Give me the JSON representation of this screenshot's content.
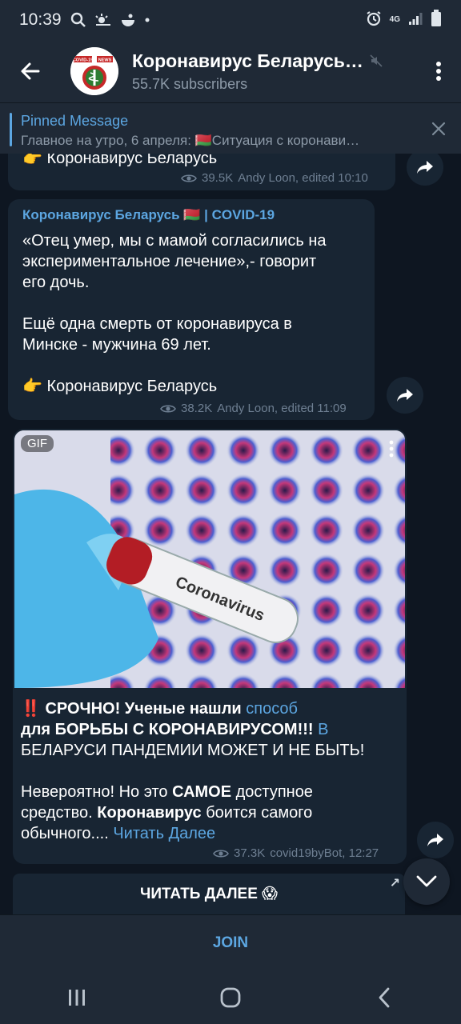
{
  "statusbar": {
    "time": "10:39",
    "network": "4G"
  },
  "header": {
    "back_icon": "arrow-left-icon",
    "title": "Коронавирус Беларусь…",
    "subscribers": "55.7K subscribers",
    "avatar_text_left": "COVID-19",
    "avatar_text_right": "NEWS"
  },
  "pinned": {
    "label": "Pinned Message",
    "text": "Главное на утро, 6 апреля: 🇧🇾Ситуация с коронави…"
  },
  "messages": [
    {
      "link": "👉 Коронавирус Беларусь",
      "views": "39.5K",
      "author": "Andy Loon, edited 10:10"
    },
    {
      "sender": "Коронавирус Беларусь 🇧🇾 | COVID-19",
      "line1": "«Отец умер, мы с мамой согласились на",
      "line2": "экспериментальное лечение»,- говорит",
      "line3": "его дочь.",
      "line4": "Ещё одна смерть от коронавируса в",
      "line5": "Минске - мужчина 69 лет.",
      "link": "👉 Коронавирус Беларусь",
      "views": "38.2K",
      "author": "Andy Loon, edited 11:09"
    },
    {
      "gif_label": "GIF",
      "tube_label": "Coronavirus",
      "p1_a": "‼️ СРОЧНО! Ученые нашли ",
      "p1_b": "способ",
      "p2_a": "для БОРЬБЫ С КОРОНАВИРУСОМ!!! ",
      "p2_b": "В",
      "p3": "БЕЛАРУСИ ПАНДЕМИИ МОЖЕТ И НЕ БЫТЬ!",
      "p4_a": "Невероятно! Но это ",
      "p4_b": "САМОЕ",
      "p4_c": " доступное",
      "p5_a": "средство. ",
      "p5_b": "Коронавирус",
      "p5_c": " боится самого",
      "p6_a": "обычного.... ",
      "p6_b": "Читать Далее",
      "views": "37.3K",
      "author": "covid19byBot, 12:27"
    }
  ],
  "readmore": {
    "label": "ЧИТАТЬ ДАЛЕЕ 😱",
    "arrow": "↗"
  },
  "join": {
    "label": "JOIN"
  },
  "colors": {
    "background": "#0e1621",
    "bubble": "#182533",
    "bar": "#1f2936",
    "accent": "#5ca6e1"
  }
}
